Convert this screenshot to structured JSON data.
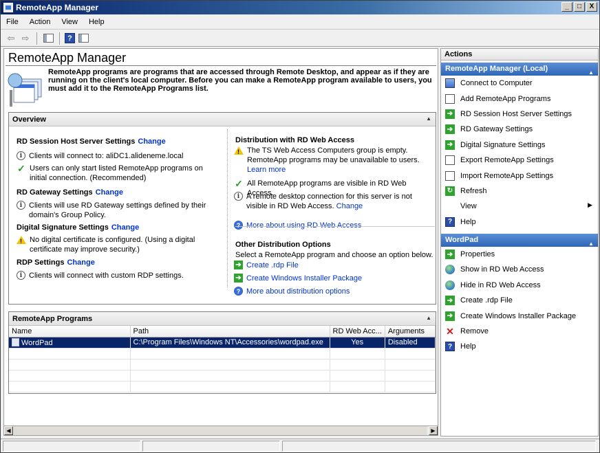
{
  "window": {
    "title": "RemoteApp Manager",
    "controls": {
      "minimize": "_",
      "restore": "□",
      "close": "X"
    }
  },
  "menu": {
    "items": [
      "File",
      "Action",
      "View",
      "Help"
    ]
  },
  "toolbar": {
    "back_icon": "back-arrow-icon",
    "forward_icon": "forward-arrow-icon",
    "console_tree_icon": "show-hide-console-tree-icon",
    "help_label": "?",
    "action_pane_icon": "show-hide-action-pane-icon"
  },
  "main": {
    "title": "RemoteApp Manager",
    "intro": "RemoteApp programs are programs that are accessed through Remote Desktop, and appear as if they are running on the client's local computer. Before you can make a RemoteApp program available to users, you must add it to the RemoteApp Programs list."
  },
  "overview": {
    "header": "Overview",
    "collapse_glyph": "▲",
    "left": {
      "rdsh": {
        "title": "RD Session Host Server Settings",
        "change": "Change",
        "items": [
          {
            "icon": "info-icon",
            "text": "Clients will connect to: aliDC1.alideneme.local"
          },
          {
            "icon": "check-icon",
            "text": "Users can only start listed RemoteApp programs on initial connection. (Recommended)"
          }
        ]
      },
      "gateway": {
        "title": "RD Gateway Settings",
        "change": "Change",
        "items": [
          {
            "icon": "info-icon",
            "text": "Clients will use RD Gateway settings defined by their domain's Group Policy."
          }
        ]
      },
      "signature": {
        "title": "Digital Signature Settings",
        "change": "Change",
        "items": [
          {
            "icon": "warning-icon",
            "text": "No digital certificate is configured. (Using a digital certificate may improve security.)"
          }
        ]
      },
      "rdp": {
        "title": "RDP Settings",
        "change": "Change",
        "items": [
          {
            "icon": "info-icon",
            "text": "Clients will connect with custom RDP settings."
          }
        ]
      }
    },
    "right": {
      "distribution": {
        "title": "Distribution with RD Web Access",
        "warning": "The TS Web Access Computers group is empty. RemoteApp programs may be unavailable to users.",
        "learn_more": "Learn more",
        "visible": "All RemoteApp programs are visible in RD Web Access.",
        "remote_conn": "A remote desktop connection for this server is not visible in RD Web Access.",
        "remote_conn_change": "Change",
        "more_about": "More about using RD Web Access"
      },
      "other": {
        "title": "Other Distribution Options",
        "desc": "Select a RemoteApp program and choose an option below.",
        "create_rdp": "Create .rdp File",
        "create_msi": "Create Windows Installer Package",
        "more_about": "More about distribution options"
      }
    }
  },
  "programs": {
    "header": "RemoteApp Programs",
    "columns": [
      "Name",
      "Path",
      "RD Web Acc...",
      "Arguments"
    ],
    "rows": [
      {
        "name": "WordPad",
        "path": "C:\\Program Files\\Windows NT\\Accessories\\wordpad.exe",
        "web": "Yes",
        "args": "Disabled"
      }
    ]
  },
  "actions": {
    "header": "Actions",
    "groups": [
      {
        "title": "RemoteApp Manager (Local)",
        "items": [
          {
            "label": "Connect to Computer",
            "icon": "computer-icon"
          },
          {
            "label": "Add RemoteApp Programs",
            "icon": "add-programs-icon"
          },
          {
            "label": "RD Session Host Server Settings",
            "icon": "green-arrow-icon"
          },
          {
            "label": "RD Gateway Settings",
            "icon": "green-arrow-icon"
          },
          {
            "label": "Digital Signature Settings",
            "icon": "green-arrow-icon"
          },
          {
            "label": "Export RemoteApp Settings",
            "icon": "export-icon"
          },
          {
            "label": "Import RemoteApp Settings",
            "icon": "import-icon"
          },
          {
            "label": "Refresh",
            "icon": "refresh-icon"
          },
          {
            "label": "View",
            "icon": "none",
            "submenu": "▶"
          },
          {
            "label": "Help",
            "icon": "help-icon"
          }
        ]
      },
      {
        "title": "WordPad",
        "items": [
          {
            "label": "Properties",
            "icon": "green-arrow-icon"
          },
          {
            "label": "Show in RD Web Access",
            "icon": "globe-icon"
          },
          {
            "label": "Hide in RD Web Access",
            "icon": "globe-icon"
          },
          {
            "label": "Create .rdp File",
            "icon": "green-arrow-icon"
          },
          {
            "label": "Create Windows Installer Package",
            "icon": "green-arrow-icon"
          },
          {
            "label": "Remove",
            "icon": "remove-icon"
          },
          {
            "label": "Help",
            "icon": "help-icon"
          }
        ]
      }
    ]
  }
}
